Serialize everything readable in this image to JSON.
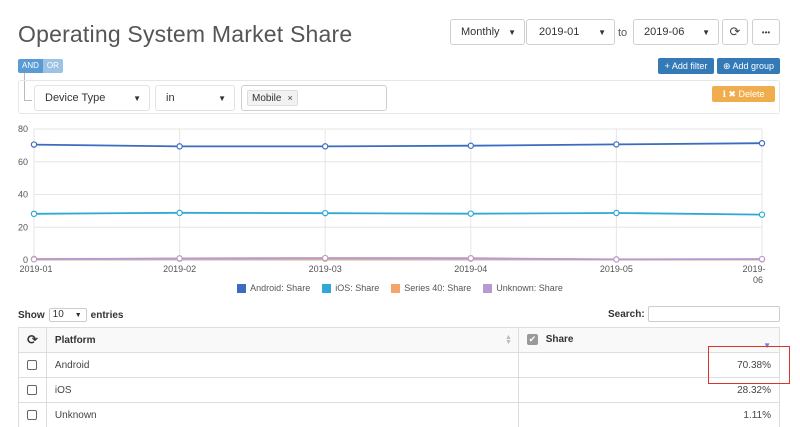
{
  "header": {
    "title": "Operating System Market Share",
    "interval": "Monthly",
    "date_from": "2019-01",
    "to_label": "to",
    "date_to": "2019-06",
    "refresh_icon": "refresh-icon",
    "more_label": "•••"
  },
  "filter": {
    "and_label": "AND",
    "or_label": "OR",
    "field": "Device Type",
    "operator": "in",
    "value_chip": "Mobile",
    "chip_remove": "×",
    "add_filter_label": "+ Add filter",
    "add_group_label": "⊕ Add group",
    "delete_label": "ℹ ✖ Delete"
  },
  "colors": {
    "android": "#3b6cbf",
    "ios": "#2ea8d6",
    "series40": "#f2a66b",
    "unknown": "#b59bd2"
  },
  "chart_data": {
    "type": "line",
    "x": [
      "2019-01",
      "2019-02",
      "2019-03",
      "2019-04",
      "2019-05",
      "2019-06"
    ],
    "series": [
      {
        "name": "Android: Share",
        "values": [
          70.5,
          69.4,
          69.4,
          69.8,
          70.6,
          71.3
        ]
      },
      {
        "name": "iOS: Share",
        "values": [
          28.2,
          28.8,
          28.6,
          28.3,
          28.7,
          27.7
        ]
      },
      {
        "name": "Series 40: Share",
        "values": [
          0.7,
          0.8,
          0.8,
          0.8,
          0.4,
          0.4
        ]
      },
      {
        "name": "Unknown: Share",
        "values": [
          0.4,
          1.0,
          1.2,
          1.1,
          0.3,
          0.6
        ]
      }
    ],
    "yticks": [
      0,
      20,
      40,
      60,
      80
    ],
    "ylim": [
      0,
      80
    ],
    "grid": true,
    "legend": "bottom"
  },
  "table": {
    "show_label": "Show",
    "page_length": "10",
    "entries_label": "entries",
    "search_label": "Search:",
    "col_platform": "Platform",
    "col_share": "Share",
    "rows": [
      {
        "platform": "Android",
        "share": "70.38%"
      },
      {
        "platform": "iOS",
        "share": "28.32%"
      },
      {
        "platform": "Unknown",
        "share": "1.11%"
      }
    ]
  }
}
